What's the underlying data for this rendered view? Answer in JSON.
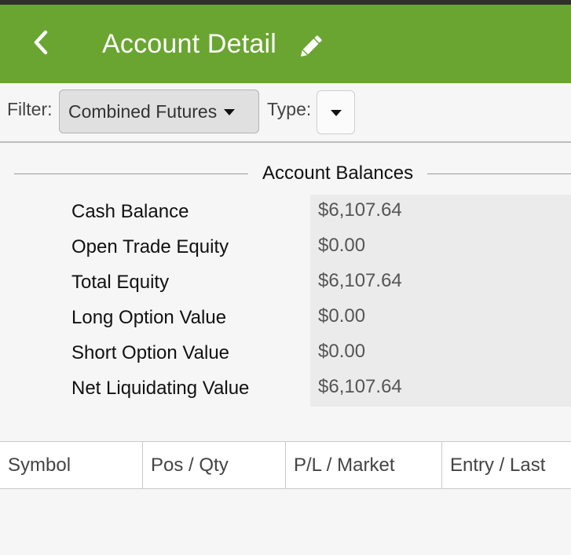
{
  "header": {
    "title": "Account Detail",
    "back_icon": "chevron-left-icon",
    "edit_icon": "pencil-icon",
    "background_color": "#6aa532"
  },
  "filter_bar": {
    "filter_label": "Filter:",
    "filter_value": "Combined Futures",
    "type_label": "Type:",
    "type_value": ""
  },
  "balances": {
    "title": "Account Balances",
    "rows": [
      {
        "label": "Cash Balance",
        "value": "$6,107.64"
      },
      {
        "label": "Open Trade Equity",
        "value": "$0.00"
      },
      {
        "label": "Total Equity",
        "value": "$6,107.64"
      },
      {
        "label": "Long Option Value",
        "value": "$0.00"
      },
      {
        "label": "Short Option Value",
        "value": "$0.00"
      },
      {
        "label": "Net Liquidating Value",
        "value": "$6,107.64"
      }
    ]
  },
  "positions": {
    "columns": [
      "Symbol",
      "Pos / Qty",
      "P/L / Market",
      "Entry / Last"
    ]
  }
}
